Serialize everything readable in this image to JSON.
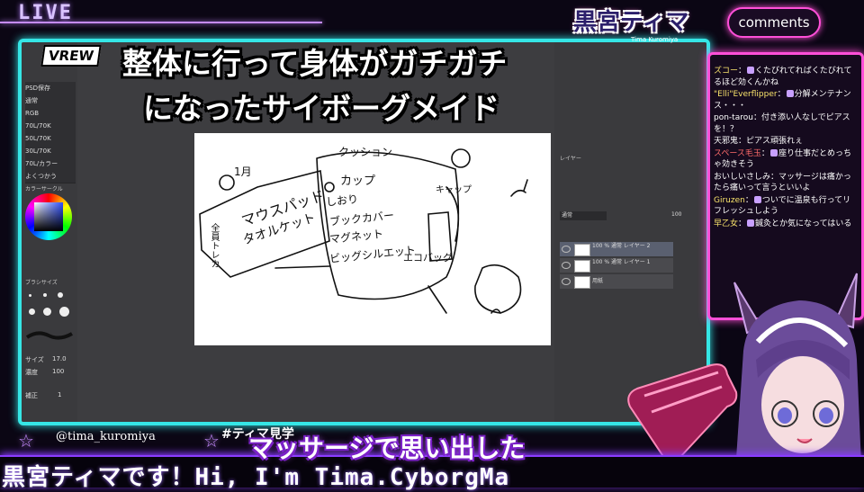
{
  "stream": {
    "live_label": "LIVE",
    "logo_text": "黒宮ティマ",
    "logo_subtext": "Tima Kuromiya",
    "handle": "@tima_kuromiya",
    "hashtag": "#ティマ見学",
    "ticker": "黒宮ティマです！Hi, I'm Tima.CyborgMa",
    "accent_color": "#35e6e6",
    "comments_accent": "#ff4fd8"
  },
  "captions": {
    "vrew_badge": "VREW",
    "line1": "整体に行って身体がガチガチ",
    "line2": "になったサイボーグメイド",
    "bottom": "マッサージで思い出した"
  },
  "comments": {
    "header": "comments",
    "items": [
      {
        "user": "ズコー",
        "message": "くたびれてればくたびれてるほど効くんかね"
      },
      {
        "user": "\"Elli\"Everflipper",
        "message": "分解メンテナンス・・・"
      },
      {
        "user": "pon-tarou",
        "message": "付き添い人なしでピアスを！？"
      },
      {
        "user": "天邪鬼",
        "message": "ピアス頑張れぇ"
      },
      {
        "user": "スペース毛玉",
        "message": "座り仕事だとめっちゃ効きそう"
      },
      {
        "user": "おいしいさしみ",
        "message": "マッサージは痛かったら痛いって言うといいよ"
      },
      {
        "user": "Giruzen",
        "message": "ついでに温泉も行ってリフレッシュしよう"
      },
      {
        "user": "早乙女",
        "message": "鍼灸とか気になってはいる"
      }
    ]
  },
  "app": {
    "left_panel": {
      "rows": [
        "PSD保存",
        "通常",
        "RGB",
        "70L/70K",
        "50L/70K",
        "30L/70K",
        "70L/カラー",
        "よくつかう"
      ],
      "color_section": "カラーサークル",
      "brush_section": "ブラシサイズ",
      "size_label": "サイズ",
      "size_value": "17.0",
      "opacity_label": "濃度",
      "opacity_value": "100",
      "correction_label": "補正",
      "correction_value": "1"
    },
    "right_panel": {
      "layer_header": "レイヤー",
      "blend_mode": "通常",
      "opacity": "100",
      "layers": [
        {
          "name": "100 % 通常 レイヤー 2",
          "selected": true
        },
        {
          "name": "100 % 通常 レイヤー 1",
          "selected": false
        },
        {
          "name": "用紙",
          "selected": false
        }
      ]
    },
    "sketch_texts": [
      "1月",
      "マウスパッド",
      "タオルケット",
      "クッション",
      "カップ",
      "しおり",
      "ブックカバー",
      "マグネット",
      "ビッグシルエット",
      "キャップ",
      "エコバッグ",
      "全員トレカ"
    ]
  }
}
